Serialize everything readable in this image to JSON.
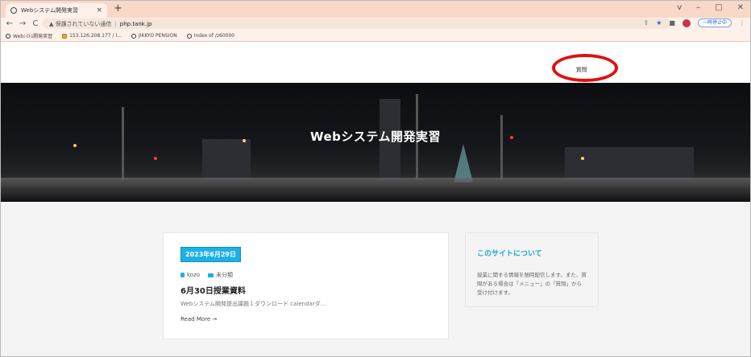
{
  "browser": {
    "tab": {
      "title": "Webシステム開発実習"
    },
    "new_tab": "+",
    "window_controls": [
      "v",
      "–",
      "□",
      "✕"
    ],
    "nav": {
      "back": "←",
      "forward": "→",
      "reload": "C"
    },
    "address": {
      "security": "▲ 保護されていない通信",
      "separator": "|",
      "host": "php.tank.jp"
    },
    "profile_button": "一時停止中",
    "bookmarks": [
      {
        "icon": "globe-icon",
        "label": "Webｼｽﾃﾑ開発実習"
      },
      {
        "icon": "folder-icon",
        "label": "153.126.208.177 / l..."
      },
      {
        "icon": "globe-icon",
        "label": "JIKKYO PENSION"
      },
      {
        "icon": "globe-icon",
        "label": "Index of /z60000"
      }
    ]
  },
  "site": {
    "menu": {
      "item": "質問",
      "dash": "–"
    },
    "hero_title": "Webシステム開発実習"
  },
  "post": {
    "date": "2023年6月29日",
    "author": "kozo",
    "category": "未分類",
    "title": "6月30日授業資料",
    "excerpt": "Webシステム開発提出課題１ダウンロード calendarダ...",
    "read_more": "Read More →"
  },
  "widget": {
    "title": "このサイトについて",
    "text": "授業に関する情報を随時配信します。また、質問がある場合は「メニュー」の「質問」から受け付けます。"
  },
  "colors": {
    "accent": "#1cb0e6",
    "highlight_ring": "#e01010",
    "tab_strip": "#f8d8c8"
  }
}
